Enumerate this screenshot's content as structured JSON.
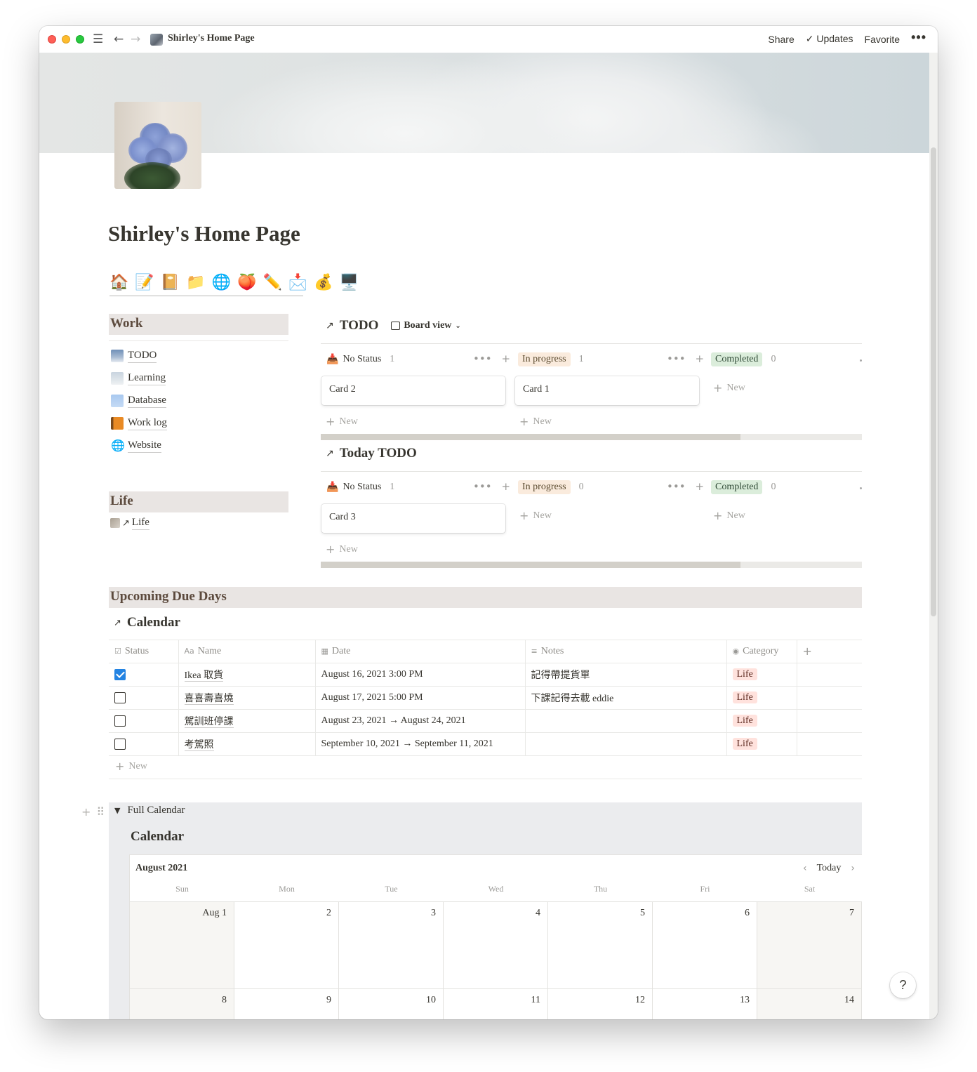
{
  "window": {
    "title": "Shirley's Home Page",
    "actions": {
      "share": "Share",
      "updates": "Updates",
      "favorite": "Favorite",
      "more": "•••"
    }
  },
  "page": {
    "title": "Shirley's Home Page",
    "emojis": [
      "🏠",
      "📝",
      "📔",
      "📁",
      "🌐",
      "🍑",
      "✏️",
      "📩",
      "💰",
      "🖥️"
    ]
  },
  "work": {
    "heading": "Work",
    "items": [
      {
        "label": "TODO"
      },
      {
        "label": "Learning"
      },
      {
        "label": "Database"
      },
      {
        "label": "Work log"
      },
      {
        "label": "Website"
      }
    ]
  },
  "life": {
    "heading": "Life",
    "items": [
      {
        "label": "Life"
      }
    ]
  },
  "todo_board": {
    "title": "TODO",
    "view": "Board view",
    "columns": [
      {
        "name": "No Status",
        "count": "1",
        "cards": [
          "Card 2"
        ]
      },
      {
        "name": "In progress",
        "count": "1",
        "cards": [
          "Card 1"
        ]
      },
      {
        "name": "Completed",
        "count": "0",
        "cards": []
      }
    ],
    "new_label": "New",
    "scroll_fraction": 0.775
  },
  "today_board": {
    "title": "Today TODO",
    "columns": [
      {
        "name": "No Status",
        "count": "1",
        "cards": [
          "Card 3"
        ]
      },
      {
        "name": "In progress",
        "count": "0",
        "cards": []
      },
      {
        "name": "Completed",
        "count": "0",
        "cards": []
      }
    ],
    "new_label": "New",
    "scroll_fraction": 0.775
  },
  "upcoming": {
    "heading": "Upcoming Due Days",
    "db_title": "Calendar",
    "columns": [
      "Status",
      "Name",
      "Date",
      "Notes",
      "Category"
    ],
    "rows": [
      {
        "done": true,
        "name": "Ikea 取貨",
        "date": "August 16, 2021 3:00 PM",
        "notes": "記得帶提貨單",
        "category": "Life"
      },
      {
        "done": false,
        "name": "喜喜壽喜燒",
        "date": "August 17, 2021 5:00 PM",
        "notes": "下課記得去載 eddie",
        "category": "Life"
      },
      {
        "done": false,
        "name": "駕訓班停課",
        "date": "August 23, 2021 → August 24, 2021",
        "notes": "",
        "category": "Life"
      },
      {
        "done": false,
        "name": "考駕照",
        "date": "September 10, 2021 → September 11, 2021",
        "notes": "",
        "category": "Life"
      }
    ],
    "new_label": "New"
  },
  "full_calendar": {
    "toggle_label": "Full Calendar",
    "title": "Calendar",
    "month": "August 2021",
    "today_label": "Today",
    "weekdays": [
      "Sun",
      "Mon",
      "Tue",
      "Wed",
      "Thu",
      "Fri",
      "Sat"
    ],
    "week1": [
      "Aug 1",
      "2",
      "3",
      "4",
      "5",
      "6",
      "7"
    ],
    "week2": [
      "8",
      "9",
      "10",
      "11",
      "12",
      "13",
      "14"
    ]
  },
  "help_label": "?"
}
